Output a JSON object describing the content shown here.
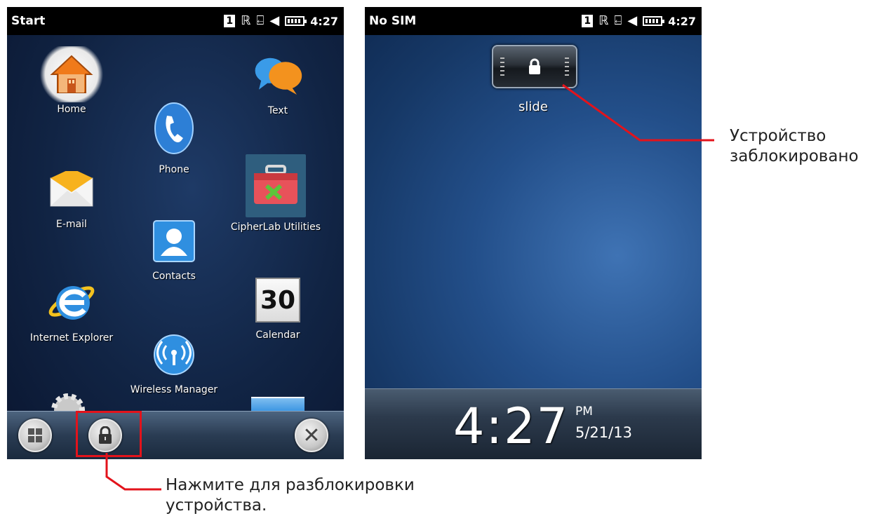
{
  "left_screen": {
    "status": {
      "title": "Start",
      "sim_slot": "1",
      "time": "4:27"
    },
    "apps": [
      {
        "label": "Home",
        "icon": "house-icon"
      },
      {
        "label": "Text",
        "icon": "speech-bubbles-icon"
      },
      {
        "label": "Phone",
        "icon": "phone-handset-icon"
      },
      {
        "label": "E-mail",
        "icon": "envelope-icon"
      },
      {
        "label": "CipherLab Utilities",
        "icon": "toolbox-icon"
      },
      {
        "label": "Contacts",
        "icon": "contact-card-icon"
      },
      {
        "label": "Internet Explorer",
        "icon": "internet-explorer-icon"
      },
      {
        "label": "Calendar",
        "icon": "calendar-icon",
        "badge": "30"
      },
      {
        "label": "Wireless Manager",
        "icon": "wireless-antenna-icon"
      }
    ],
    "taskbar": {
      "start_icon": "windows-logo-icon",
      "lock_icon": "padlock-icon",
      "close_icon": "close-icon"
    }
  },
  "right_screen": {
    "status": {
      "title": "No SIM",
      "sim_slot": "1",
      "time": "4:27"
    },
    "lock_slider_label": "slide",
    "clock": {
      "time": "4:27",
      "ampm": "PM",
      "date": "5/21/13"
    }
  },
  "annotations": {
    "locked_line1": "Устройство",
    "locked_line2": "заблокировано",
    "unlock_line1": "Нажмите для разблокировки",
    "unlock_line2": "устройства."
  },
  "colors": {
    "highlight": "#e3131b",
    "taskbar": "#2a3c53"
  }
}
